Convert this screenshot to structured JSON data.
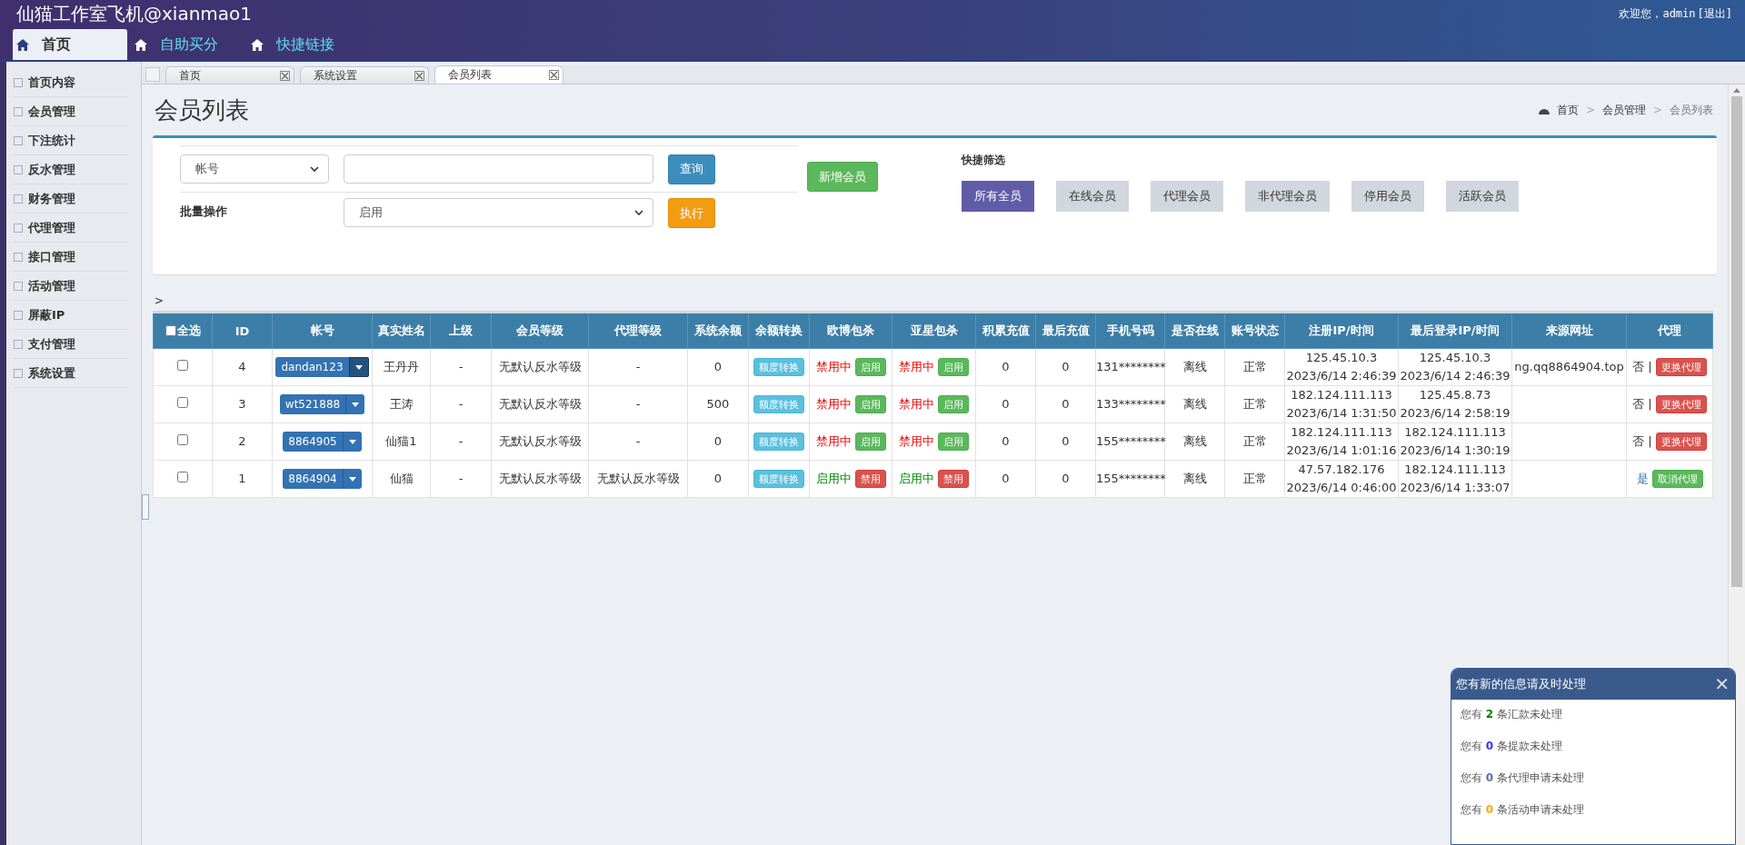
{
  "header": {
    "title": "仙猫工作室飞机@xianmao1",
    "welcome": "欢迎您，admin",
    "logout": "[退出]"
  },
  "nav": [
    {
      "label": "首页",
      "selected": true
    },
    {
      "label": "自助买分",
      "selected": false
    },
    {
      "label": "快捷链接",
      "selected": false
    }
  ],
  "sidebar": {
    "items": [
      "首页内容",
      "会员管理",
      "下注统计",
      "反水管理",
      "财务管理",
      "代理管理",
      "接口管理",
      "活动管理",
      "屏蔽IP",
      "支付管理",
      "系统设置"
    ]
  },
  "page_tabs": [
    {
      "label": "首页",
      "selected": false
    },
    {
      "label": "系统设置",
      "selected": false
    },
    {
      "label": "会员列表",
      "selected": true
    }
  ],
  "page": {
    "title": "会员列表",
    "breadcrumb": [
      "首页",
      "会员管理",
      "会员列表"
    ],
    "breadcrumb_separators": [
      ">",
      ">"
    ]
  },
  "filter": {
    "field_select": "帐号",
    "query_button": "查询",
    "add_button": "新增会员",
    "batch_label": "批量操作",
    "batch_select": "启用",
    "execute_button": "执行",
    "quick_title": "快捷筛选",
    "quick": [
      {
        "label": "所有全员",
        "selected": true
      },
      {
        "label": "在线会员",
        "selected": false
      },
      {
        "label": "代理会员",
        "selected": false
      },
      {
        "label": "非代理会员",
        "selected": false
      },
      {
        "label": "停用会员",
        "selected": false
      },
      {
        "label": "活跃会员",
        "selected": false
      }
    ]
  },
  "breadcrumb_marker": ">",
  "table": {
    "select_all": "全选",
    "select_all_checked": false,
    "columns": [
      "ID",
      "帐号",
      "真实姓名",
      "上级",
      "会员等级",
      "代理等级",
      "系统余额",
      "余额转换",
      "欧博包杀",
      "亚星包杀",
      "积累充值",
      "最后充值",
      "手机号码",
      "是否在线",
      "账号状态",
      "注册IP/时间",
      "最后登录IP/时间",
      "来源网址",
      "代理"
    ],
    "rows": [
      {
        "checked": false,
        "id": "4",
        "account": "dandan123",
        "account_active": true,
        "name": "王丹丹",
        "parent": "-",
        "member_level": "无默认反水等级",
        "agent_level": "-",
        "balance": "0",
        "transfer": "额度转换",
        "ob": {
          "label": "禁用中",
          "button": "启用",
          "enabled": false
        },
        "yx": {
          "label": "禁用中",
          "button": "启用",
          "enabled": false
        },
        "total_recharge": "0",
        "last_recharge": "0",
        "phone": "131********",
        "online": "离线",
        "status": "正常",
        "reg_ip": "125.45.10.3",
        "reg_time": "2023/6/14 2:46:39",
        "login_ip": "125.45.10.3",
        "login_time": "2023/6/14 2:46:39",
        "source": "ng.qq8864904.top",
        "agent": {
          "label": "否 |",
          "button": "更换代理",
          "is_agent": false
        }
      },
      {
        "checked": false,
        "id": "3",
        "account": "wt521888",
        "account_active": false,
        "name": "王涛",
        "parent": "-",
        "member_level": "无默认反水等级",
        "agent_level": "-",
        "balance": "500",
        "transfer": "额度转换",
        "ob": {
          "label": "禁用中",
          "button": "启用",
          "enabled": false
        },
        "yx": {
          "label": "禁用中",
          "button": "启用",
          "enabled": false
        },
        "total_recharge": "0",
        "last_recharge": "0",
        "phone": "133********",
        "online": "离线",
        "status": "正常",
        "reg_ip": "182.124.111.113",
        "reg_time": "2023/6/14 1:31:50",
        "login_ip": "125.45.8.73",
        "login_time": "2023/6/14 2:58:19",
        "agent": {
          "label": "否 |",
          "button": "更换代理",
          "is_agent": false
        }
      },
      {
        "checked": false,
        "id": "2",
        "account": "8864905",
        "account_active": false,
        "name": "仙猫1",
        "parent": "-",
        "member_level": "无默认反水等级",
        "agent_level": "-",
        "balance": "0",
        "transfer": "额度转换",
        "ob": {
          "label": "禁用中",
          "button": "启用",
          "enabled": false
        },
        "yx": {
          "label": "禁用中",
          "button": "启用",
          "enabled": false
        },
        "total_recharge": "0",
        "last_recharge": "0",
        "phone": "155********",
        "online": "离线",
        "status": "正常",
        "reg_ip": "182.124.111.113",
        "reg_time": "2023/6/14 1:01:16",
        "login_ip": "182.124.111.113",
        "login_time": "2023/6/14 1:30:19",
        "agent": {
          "label": "否 |",
          "button": "更换代理",
          "is_agent": false
        }
      },
      {
        "checked": false,
        "id": "1",
        "account": "8864904",
        "account_active": false,
        "name": "仙猫",
        "parent": "-",
        "member_level": "无默认反水等级",
        "agent_level": "无默认反水等级",
        "balance": "0",
        "transfer": "额度转换",
        "ob": {
          "label": "启用中",
          "button": "禁用",
          "enabled": true
        },
        "yx": {
          "label": "启用中",
          "button": "禁用",
          "enabled": true
        },
        "total_recharge": "0",
        "last_recharge": "0",
        "phone": "155********",
        "online": "离线",
        "status": "正常",
        "reg_ip": "47.57.182.176",
        "reg_time": "2023/6/14 0:46:00",
        "login_ip": "182.124.111.113",
        "login_time": "2023/6/14 1:33:07",
        "agent": {
          "label": "是",
          "button": "取消代理",
          "is_agent": true
        }
      }
    ]
  },
  "popup": {
    "title": "您有新的信息请及时处理",
    "close": "✕",
    "messages": [
      {
        "prefix": "您有",
        "count": "2",
        "suffix": "条汇款未处理",
        "color": "#008000"
      },
      {
        "prefix": "您有",
        "count": "0",
        "suffix": "条提款未处理",
        "color": "#3333ff"
      },
      {
        "prefix": "您有",
        "count": "0",
        "suffix": "条代理申请未处理",
        "color": "#5a6fa0"
      },
      {
        "prefix": "您有",
        "count": "0",
        "suffix": "条活动申请未处理",
        "color": "#ffa500"
      }
    ]
  }
}
